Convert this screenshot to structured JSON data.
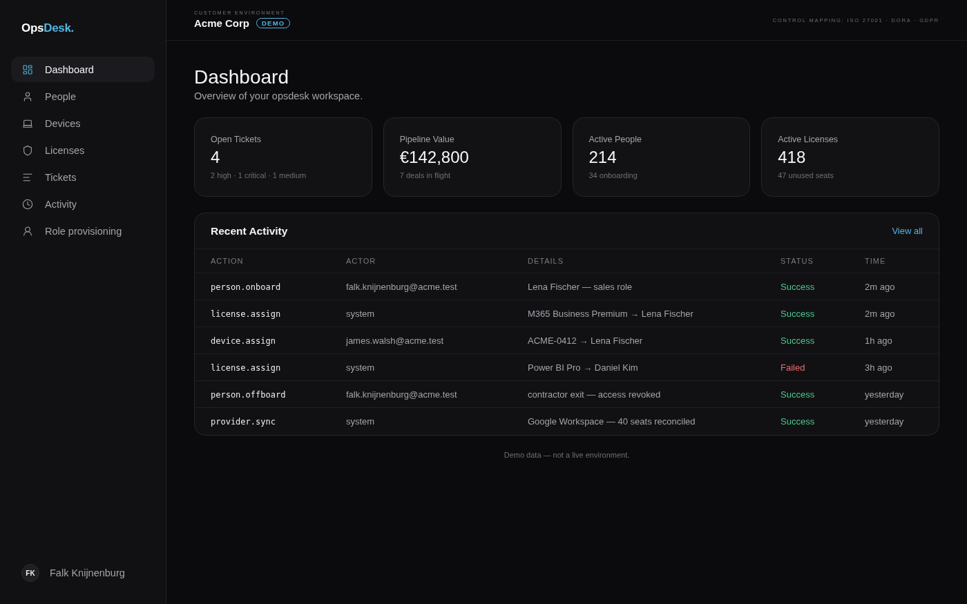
{
  "sidebar": {
    "logo": {
      "primary": "Ops",
      "accent": "Desk."
    },
    "items": [
      {
        "label": "Dashboard",
        "selected": true
      },
      {
        "label": "People",
        "selected": false
      },
      {
        "label": "Devices",
        "selected": false
      },
      {
        "label": "Licenses",
        "selected": false
      },
      {
        "label": "Tickets",
        "selected": false
      },
      {
        "label": "Activity",
        "selected": false
      },
      {
        "label": "Role provisioning",
        "selected": false
      }
    ],
    "user": {
      "initials": "FK",
      "name": "Falk Knijnenburg"
    }
  },
  "header": {
    "kicker": "CUSTOMER ENVIRONMENT",
    "customer": "Acme Corp",
    "badge": "DEMO",
    "compliance": "CONTROL MAPPING: ISO 27001 · DORA · GDPR"
  },
  "page": {
    "title": "Dashboard",
    "subtitle": "Overview of your opsdesk workspace."
  },
  "stats": [
    {
      "label": "Open Tickets",
      "value": "4",
      "detail": "2 high · 1 critical · 1 medium"
    },
    {
      "label": "Pipeline Value",
      "value": "€142,800",
      "detail": "7 deals in flight"
    },
    {
      "label": "Active People",
      "value": "214",
      "detail": "34 onboarding"
    },
    {
      "label": "Active Licenses",
      "value": "418",
      "detail": "47 unused seats"
    }
  ],
  "activity": {
    "title": "Recent Activity",
    "link": "View all",
    "columns": [
      "ACTION",
      "ACTOR",
      "DETAILS",
      "STATUS",
      "TIME"
    ],
    "rows": [
      {
        "action": "person.onboard",
        "actor": "falk.knijnenburg@acme.test",
        "details": "Lena Fischer — sales role",
        "status": {
          "text": "Success",
          "kind": "success"
        },
        "time": "2m ago"
      },
      {
        "action": "license.assign",
        "actor": "system",
        "details": "M365 Business Premium → Lena Fischer",
        "status": {
          "text": "Success",
          "kind": "success"
        },
        "time": "2m ago"
      },
      {
        "action": "device.assign",
        "actor": "james.walsh@acme.test",
        "details": "ACME-0412 → Lena Fischer",
        "status": {
          "text": "Success",
          "kind": "success"
        },
        "time": "1h ago"
      },
      {
        "action": "license.assign",
        "actor": "system",
        "details": "Power BI Pro → Daniel Kim",
        "status": {
          "text": "Failed",
          "kind": "failure"
        },
        "time": "3h ago"
      },
      {
        "action": "person.offboard",
        "actor": "falk.knijnenburg@acme.test",
        "details": "contractor exit — access revoked",
        "status": {
          "text": "Success",
          "kind": "success"
        },
        "time": "yesterday"
      },
      {
        "action": "provider.sync",
        "actor": "system",
        "details": "Google Workspace — 40 seats reconciled",
        "status": {
          "text": "Success",
          "kind": "success"
        },
        "time": "yesterday"
      }
    ]
  },
  "footnote": "Demo data — not a live environment."
}
